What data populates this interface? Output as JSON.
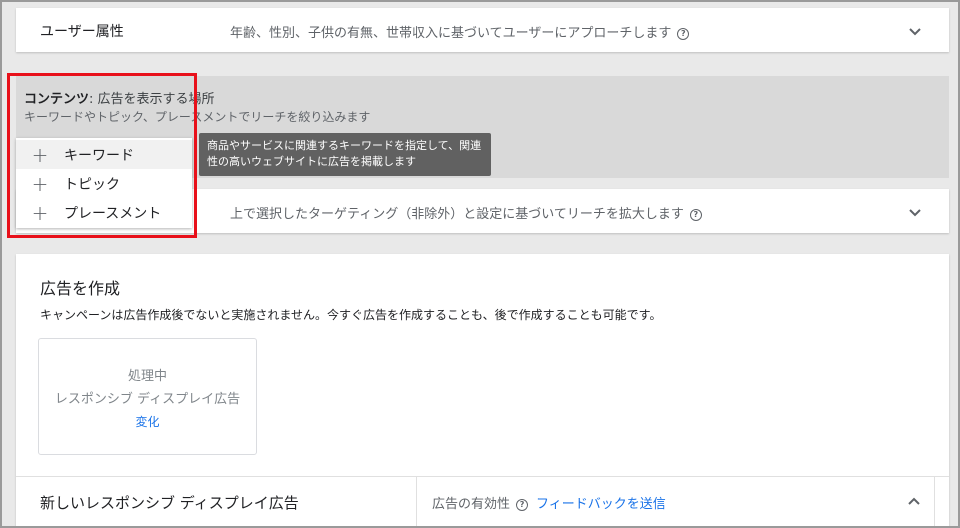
{
  "user_attributes": {
    "title": "ユーザー属性",
    "description": "年齢、性別、子供の有無、世帯収入に基づいてユーザーにアプローチします"
  },
  "content": {
    "title_bold": "コンテンツ",
    "title_rest": ": 広告を表示する場所",
    "subtitle": "キーワードやトピック、プレースメントでリーチを絞り込みます",
    "menu_items": [
      "キーワード",
      "トピック",
      "プレースメント"
    ],
    "tooltip_line1": "商品やサービスに関連するキーワードを指定して、関連",
    "tooltip_line2": "性の高いウェブサイトに広告を掲載します"
  },
  "expansion": {
    "description": "上で選択したターゲティング（非除外）と設定に基づいてリーチを拡大します"
  },
  "create_ad": {
    "title": "広告を作成",
    "note": "キャンペーンは広告作成後でないと実施されません。今すぐ広告を作成することも、後で作成することも可能です。",
    "card_status": "処理中",
    "card_type": "レスポンシブ ディスプレイ広告",
    "card_action": "変化"
  },
  "new_ad": {
    "title": "新しいレスポンシブ ディスプレイ広告",
    "effect_label": "広告の有効性",
    "feedback_link": "フィードバックを送信"
  },
  "colors": {
    "highlight_box": "#e8101a",
    "link": "#1a73e8",
    "tooltip_bg": "#616161"
  }
}
